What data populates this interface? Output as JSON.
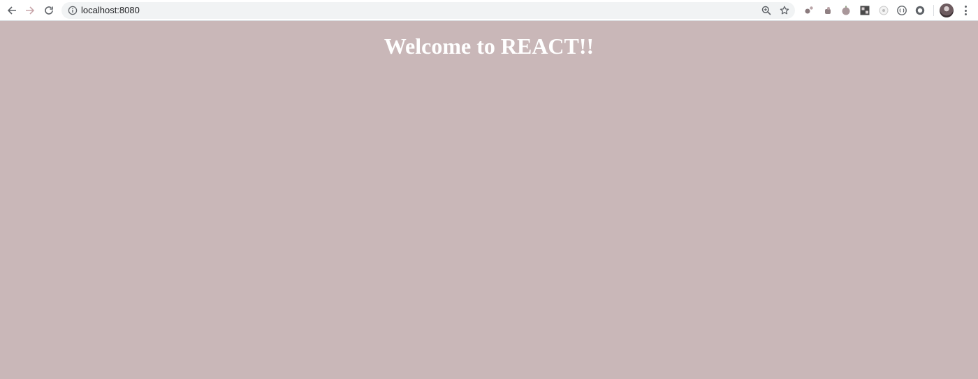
{
  "browser": {
    "url": "localhost:8080",
    "icons": {
      "back": "arrow-left-icon",
      "forward": "arrow-right-icon",
      "reload": "reload-icon",
      "site_info": "info-icon",
      "zoom": "zoom-icon",
      "bookmark": "star-icon",
      "menu": "kebab-menu-icon"
    },
    "extensions": [
      "extension-icon-1",
      "extension-icon-2",
      "extension-icon-3",
      "extension-icon-4",
      "extension-icon-5",
      "extension-icon-6",
      "extension-icon-7"
    ]
  },
  "page": {
    "heading": "Welcome to REACT!!"
  },
  "colors": {
    "page_background": "#c9b7b8",
    "heading_color": "#ffffff",
    "forward_arrow": "#c9a7ab",
    "icon_gray": "#5f6368"
  }
}
